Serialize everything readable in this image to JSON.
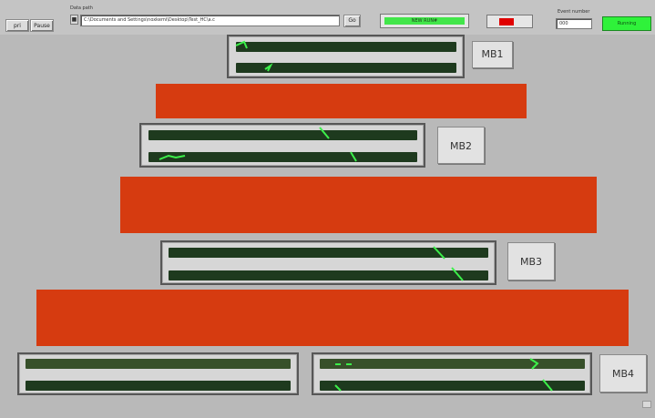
{
  "toolbar": {
    "button_left": "pri",
    "button_pause": "Pause",
    "data_path_label": "Data path",
    "data_path_value": "C:\\Documents and Settings\\noxkemi\\Desktop\\Test_HC\\a.c",
    "data_path_icon": "folder-icon",
    "go_label": "Go",
    "status_label": "NEW RUN#",
    "event_number_label": "Event number",
    "event_number_value": "000",
    "running_label": "Running"
  },
  "colors": {
    "background": "#b9b9b9",
    "track": "#1e3a1e",
    "signal": "#3cf04a",
    "bar": "#d63b10",
    "running": "#2ff23a",
    "stop": "#e00000"
  },
  "modules": {
    "mb1": "MB1",
    "mb2": "MB2",
    "mb3": "MB3",
    "mb4": "MB4"
  }
}
